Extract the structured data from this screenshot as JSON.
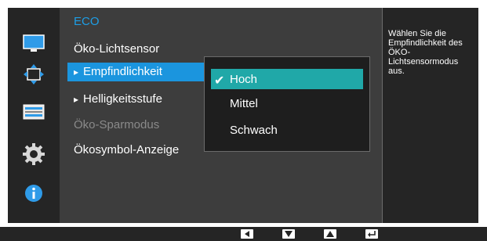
{
  "icons": [
    "monitor-icon",
    "move-arrows-icon",
    "stripes-icon",
    "gear-icon",
    "info-icon"
  ],
  "menu": {
    "title": "ECO",
    "items": [
      {
        "label": "Öko-Lichtsensor"
      },
      {
        "label": "Empfindlichkeit"
      },
      {
        "label": "Helligkeitsstufe"
      },
      {
        "label": "Öko-Sparmodus"
      },
      {
        "label": "Ökosymbol-Anzeige"
      }
    ]
  },
  "submenu": {
    "items": [
      "Hoch",
      "Mittel",
      "Schwach"
    ],
    "selected": "Hoch"
  },
  "help": {
    "text": "Wählen Sie die Empfindlichkeit des ÖKO-Lichtsensormodus aus."
  },
  "nav_buttons": [
    "left-arrow-icon",
    "down-arrow-icon",
    "up-arrow-icon",
    "enter-icon"
  ],
  "colors": {
    "title": "#1d9ee6",
    "menu_selection": "#1b95de",
    "submenu_selection": "#20a8a8"
  }
}
